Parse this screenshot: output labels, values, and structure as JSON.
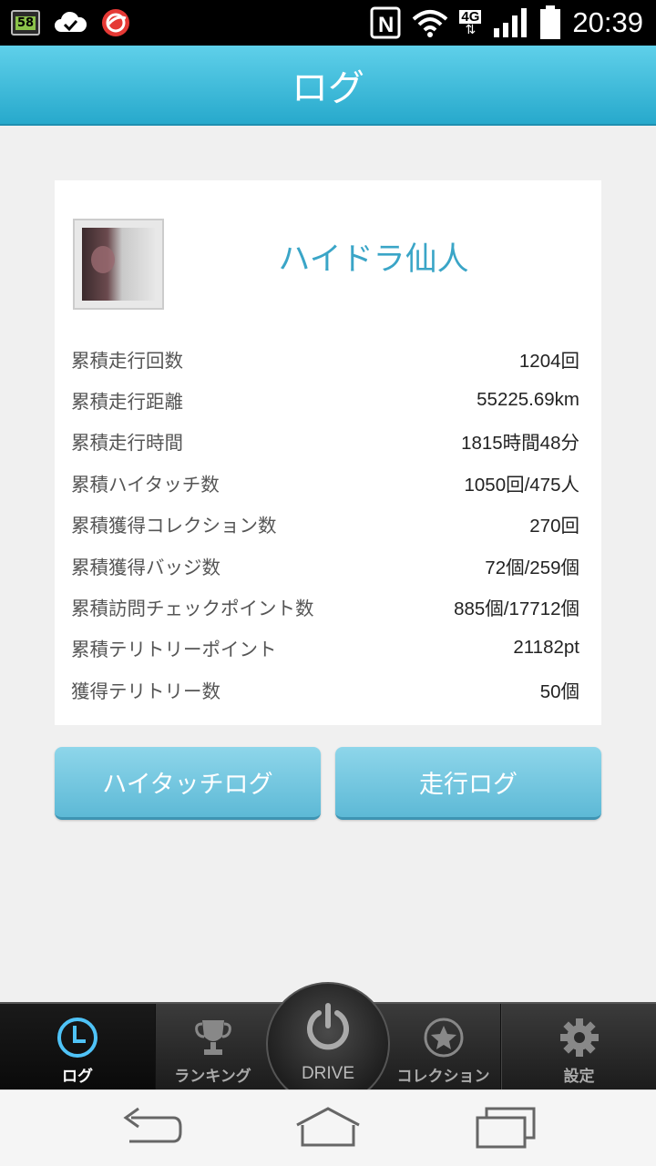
{
  "status_bar": {
    "notification_badge": "58",
    "network_type": "4G",
    "time": "20:39",
    "icons": [
      "badge-58-icon",
      "cloud-check-icon",
      "trend-micro-icon",
      "nfc-icon",
      "wifi-icon",
      "4g-icon",
      "signal-icon",
      "battery-icon"
    ]
  },
  "header": {
    "title": "ログ"
  },
  "profile": {
    "username": "ハイドラ仙人"
  },
  "stats": [
    {
      "label": "累積走行回数",
      "value": "1204回"
    },
    {
      "label": "累積走行距離",
      "value": "55225.69km"
    },
    {
      "label": "累積走行時間",
      "value": "1815時間48分"
    },
    {
      "label": "累積ハイタッチ数",
      "value": "1050回/475人"
    },
    {
      "label": "累積獲得コレクション数",
      "value": "270回"
    },
    {
      "label": "累積獲得バッジ数",
      "value": "72個/259個"
    },
    {
      "label": "累積訪問チェックポイント数",
      "value": "885個/17712個"
    },
    {
      "label": "累積テリトリーポイント",
      "value": "21182pt"
    },
    {
      "label": "獲得テリトリー数",
      "value": "50個"
    }
  ],
  "buttons": {
    "hitouch_log": "ハイタッチログ",
    "drive_log": "走行ログ"
  },
  "tabbar": {
    "log": "ログ",
    "ranking": "ランキング",
    "drive": "DRIVE",
    "collection": "コレクション",
    "settings": "設定",
    "active": "log"
  },
  "colors": {
    "accent": "#3aa5c7",
    "header": "#27a9cc",
    "button": "#6ec3dd"
  }
}
